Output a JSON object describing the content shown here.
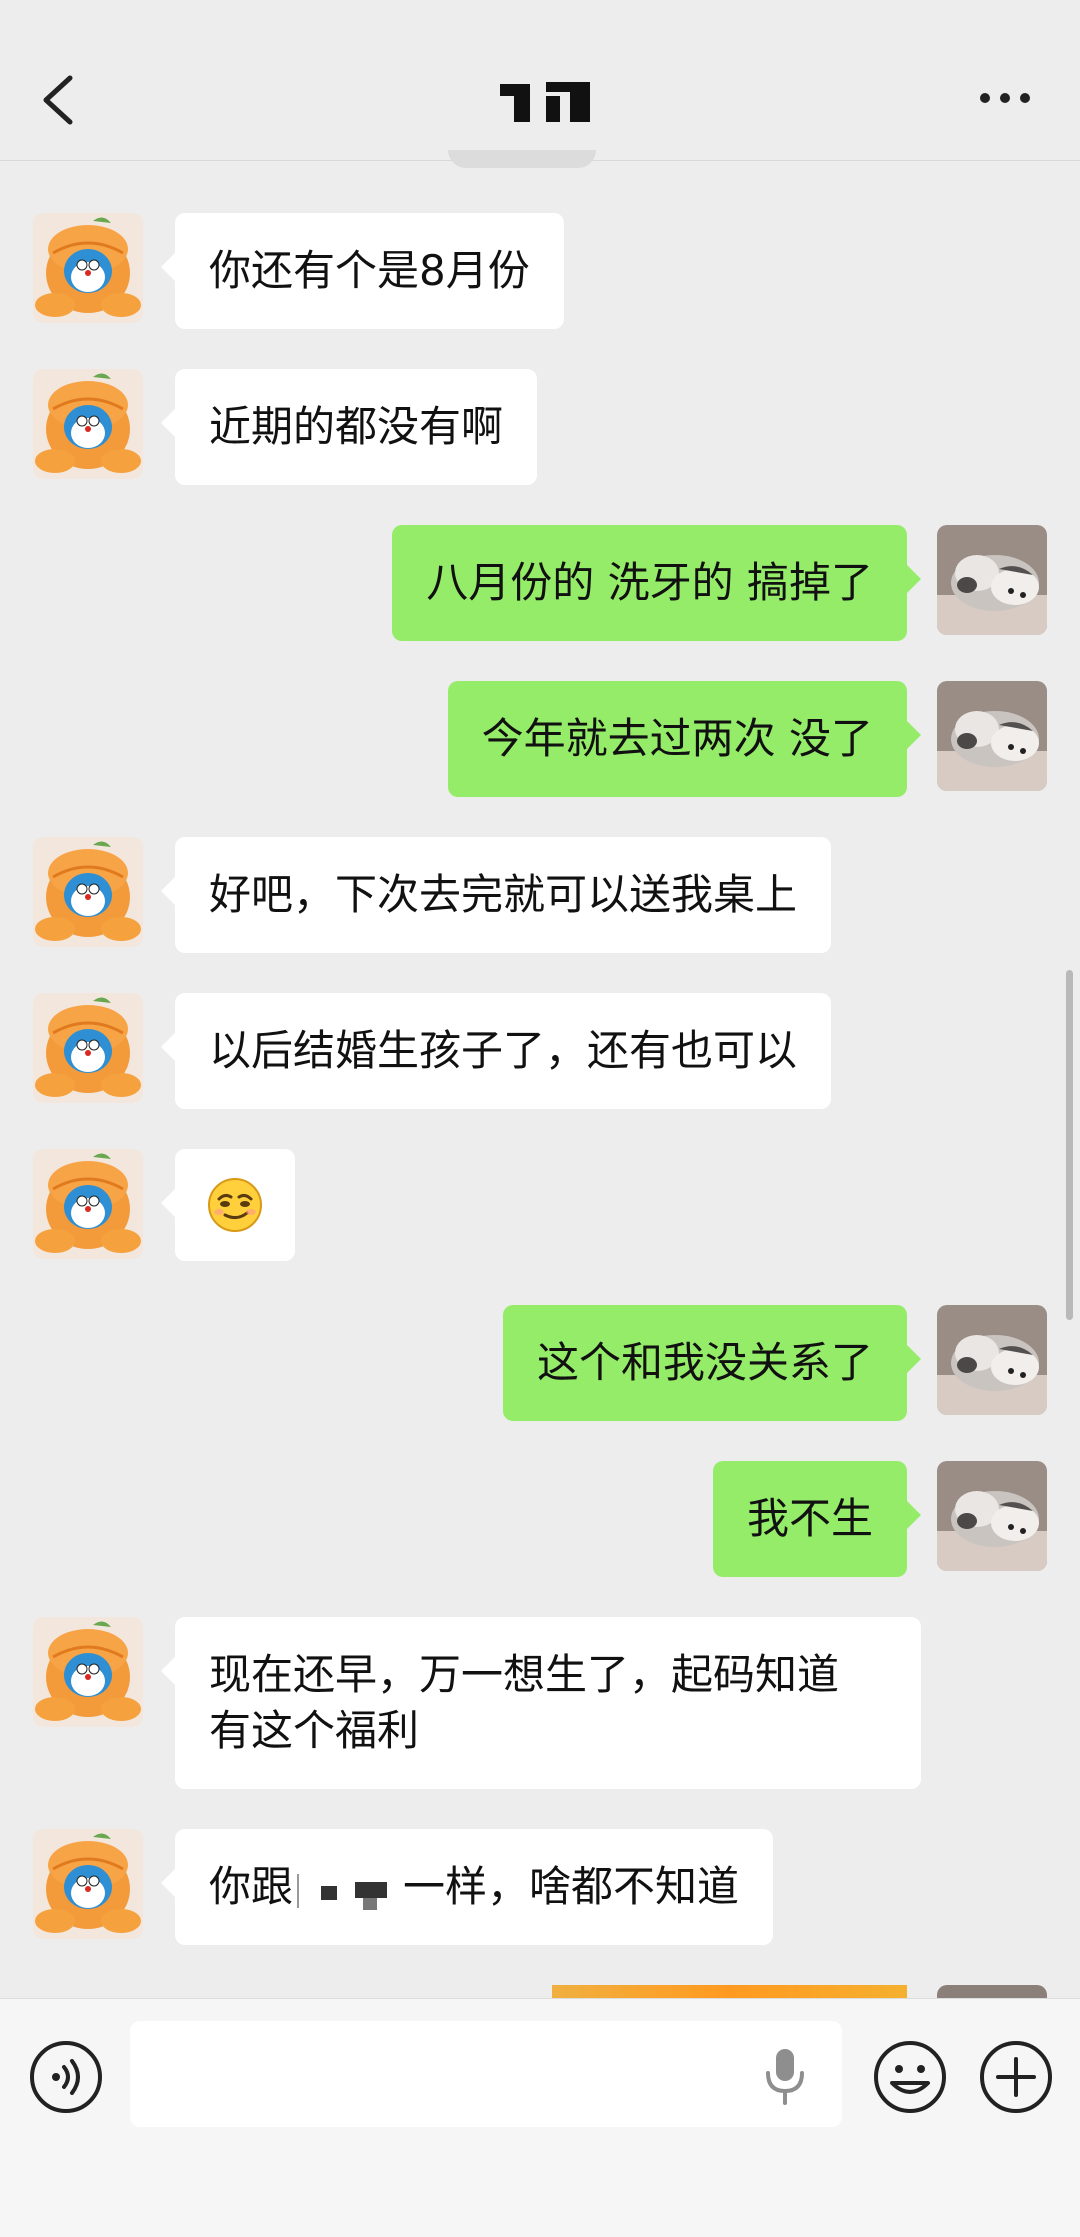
{
  "header": {
    "title_icon": "redacted-name",
    "back_icon": "chevron-left-icon",
    "more_icon": "more-dots-icon"
  },
  "messages": [
    {
      "side": "left",
      "text": "你还有个是8月份"
    },
    {
      "side": "left",
      "text": "近期的都没有啊"
    },
    {
      "side": "right",
      "text": "八月份的 洗牙的 搞掉了"
    },
    {
      "side": "right",
      "text": "今年就去过两次 没了"
    },
    {
      "side": "left",
      "text": "好吧，下次去完就可以送我桌上"
    },
    {
      "side": "left",
      "text": "以后结婚生孩子了，还有也可以"
    },
    {
      "side": "left",
      "emoji": "smirk-emoji-icon"
    },
    {
      "side": "right",
      "text": "这个和我没关系了"
    },
    {
      "side": "right",
      "text": "我不生"
    },
    {
      "side": "left",
      "text_line1": "现在还早，万一想生了，起码知道",
      "text_line2": "有这个福利"
    },
    {
      "side": "left",
      "text_before": "你跟",
      "text_after": "一样，啥都不知道"
    }
  ],
  "input_bar": {
    "voice_icon": "voice-icon",
    "input_placeholder": "",
    "mic_icon": "mic-icon",
    "emoji_icon": "emoji-icon",
    "plus_icon": "plus-icon"
  },
  "colors": {
    "background": "#ededed",
    "bubble_self": "#95ec69",
    "bubble_other": "#ffffff"
  }
}
